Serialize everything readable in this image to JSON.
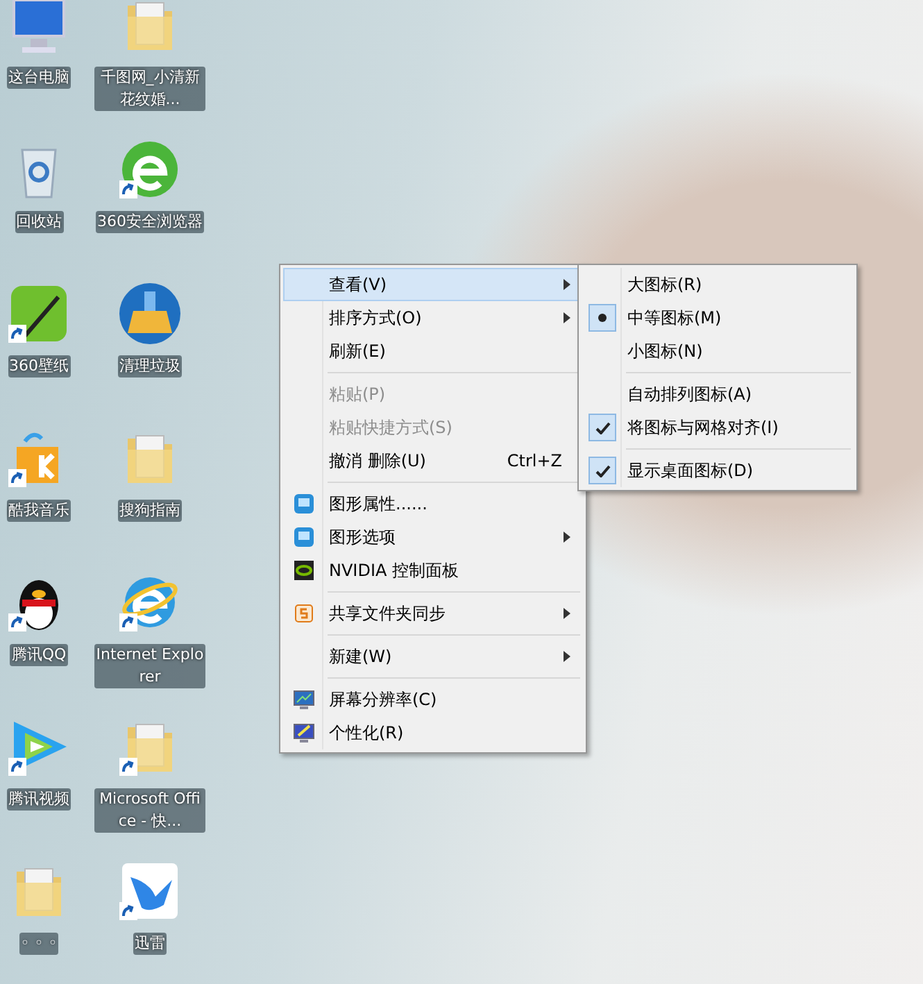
{
  "desktop_icons": [
    {
      "label": "这台电脑",
      "kind": "computer",
      "shortcut": false
    },
    {
      "label": "千图网_小清新花纹婚...",
      "kind": "folder",
      "shortcut": false
    },
    {
      "label": "回收站",
      "kind": "recycle-bin",
      "shortcut": false
    },
    {
      "label": "360安全浏览器",
      "kind": "green-browser",
      "shortcut": true
    },
    {
      "label": "360壁纸",
      "kind": "wallpaper-app",
      "shortcut": true
    },
    {
      "label": "清理垃圾",
      "kind": "broom",
      "shortcut": false
    },
    {
      "label": "酷我音乐",
      "kind": "music-box",
      "shortcut": true
    },
    {
      "label": "搜狗指南",
      "kind": "folder",
      "shortcut": false
    },
    {
      "label": "腾讯QQ",
      "kind": "penguin",
      "shortcut": true
    },
    {
      "label": "Internet Explorer",
      "kind": "blue-browser",
      "shortcut": true
    },
    {
      "label": "腾讯视频",
      "kind": "play",
      "shortcut": true
    },
    {
      "label": "Microsoft Office - 快...",
      "kind": "folder",
      "shortcut": true
    },
    {
      "label": "◦ ◦ ◦",
      "kind": "folder",
      "shortcut": false
    },
    {
      "label": "迅雷",
      "kind": "bird",
      "shortcut": true
    }
  ],
  "context_menu": {
    "items": [
      {
        "kind": "item",
        "label": "查看(V)",
        "submenu": true,
        "selected": true,
        "disabled": false
      },
      {
        "kind": "item",
        "label": "排序方式(O)",
        "submenu": true,
        "selected": false,
        "disabled": false
      },
      {
        "kind": "item",
        "label": "刷新(E)",
        "submenu": false,
        "selected": false,
        "disabled": false
      },
      {
        "kind": "separator"
      },
      {
        "kind": "item",
        "label": "粘贴(P)",
        "submenu": false,
        "selected": false,
        "disabled": true
      },
      {
        "kind": "item",
        "label": "粘贴快捷方式(S)",
        "submenu": false,
        "selected": false,
        "disabled": true
      },
      {
        "kind": "item",
        "label": "撤消 删除(U)",
        "shortcut": "Ctrl+Z",
        "submenu": false,
        "selected": false,
        "disabled": false
      },
      {
        "kind": "separator"
      },
      {
        "kind": "graphics",
        "label": "图形属性......",
        "submenu": false,
        "selected": false,
        "disabled": false
      },
      {
        "kind": "graphics",
        "label": "图形选项",
        "submenu": true,
        "selected": false,
        "disabled": false
      },
      {
        "kind": "nvidia",
        "label": "NVIDIA 控制面板",
        "submenu": false,
        "selected": false,
        "disabled": false
      },
      {
        "kind": "separator"
      },
      {
        "kind": "sync",
        "label": "共享文件夹同步",
        "submenu": true,
        "selected": false,
        "disabled": false
      },
      {
        "kind": "separator"
      },
      {
        "kind": "item",
        "label": "新建(W)",
        "submenu": true,
        "selected": false,
        "disabled": false
      },
      {
        "kind": "separator"
      },
      {
        "kind": "display",
        "label": "屏幕分辨率(C)",
        "submenu": false,
        "selected": false,
        "disabled": false
      },
      {
        "kind": "personalize",
        "label": "个性化(R)",
        "submenu": false,
        "selected": false,
        "disabled": false
      }
    ]
  },
  "view_submenu": {
    "items": [
      {
        "kind": "radio",
        "label": "大图标(R)",
        "selected": false
      },
      {
        "kind": "radio",
        "label": "中等图标(M)",
        "selected": true
      },
      {
        "kind": "radio",
        "label": "小图标(N)",
        "selected": false
      },
      {
        "kind": "separator"
      },
      {
        "kind": "check",
        "label": "自动排列图标(A)",
        "checked": false
      },
      {
        "kind": "check",
        "label": "将图标与网格对齐(I)",
        "checked": true
      },
      {
        "kind": "separator"
      },
      {
        "kind": "check",
        "label": "显示桌面图标(D)",
        "checked": true
      }
    ]
  }
}
